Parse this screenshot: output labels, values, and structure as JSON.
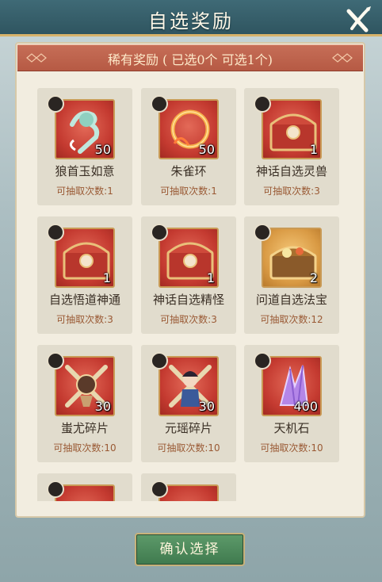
{
  "header": {
    "title": "自选奖励",
    "close_icon": "close-icon"
  },
  "banner": {
    "title": "稀有奖励 ( 已选0个 可选1个)"
  },
  "items": [
    {
      "name": "狼首玉如意",
      "quantity": "50",
      "draws": "可抽取次数:1",
      "icon": "jade-ruyi-icon",
      "bg": "red"
    },
    {
      "name": "朱雀环",
      "quantity": "50",
      "draws": "可抽取次数:1",
      "icon": "ring-icon",
      "bg": "red"
    },
    {
      "name": "神话自选灵兽",
      "quantity": "1",
      "draws": "可抽取次数:3",
      "icon": "chest-icon",
      "bg": "red"
    },
    {
      "name": "自选悟道神通",
      "quantity": "1",
      "draws": "可抽取次数:3",
      "icon": "chest-icon",
      "bg": "red"
    },
    {
      "name": "神话自选精怪",
      "quantity": "1",
      "draws": "可抽取次数:3",
      "icon": "chest-icon",
      "bg": "red"
    },
    {
      "name": "问道自选法宝",
      "quantity": "2",
      "draws": "可抽取次数:12",
      "icon": "treasure-chest-icon",
      "bg": "gold"
    },
    {
      "name": "蚩尤碎片",
      "quantity": "30",
      "draws": "可抽取次数:10",
      "icon": "warrior-shard-icon",
      "bg": "red"
    },
    {
      "name": "元瑶碎片",
      "quantity": "30",
      "draws": "可抽取次数:10",
      "icon": "maiden-shard-icon",
      "bg": "red"
    },
    {
      "name": "天机石",
      "quantity": "400",
      "draws": "可抽取次数:10",
      "icon": "crystal-icon",
      "bg": "red"
    },
    {
      "name": "",
      "quantity": "",
      "draws": "",
      "icon": "partial-item-icon",
      "bg": "red"
    },
    {
      "name": "",
      "quantity": "",
      "draws": "",
      "icon": "partial-item-icon",
      "bg": "red"
    }
  ],
  "confirm_button": {
    "label": "确认选择"
  }
}
